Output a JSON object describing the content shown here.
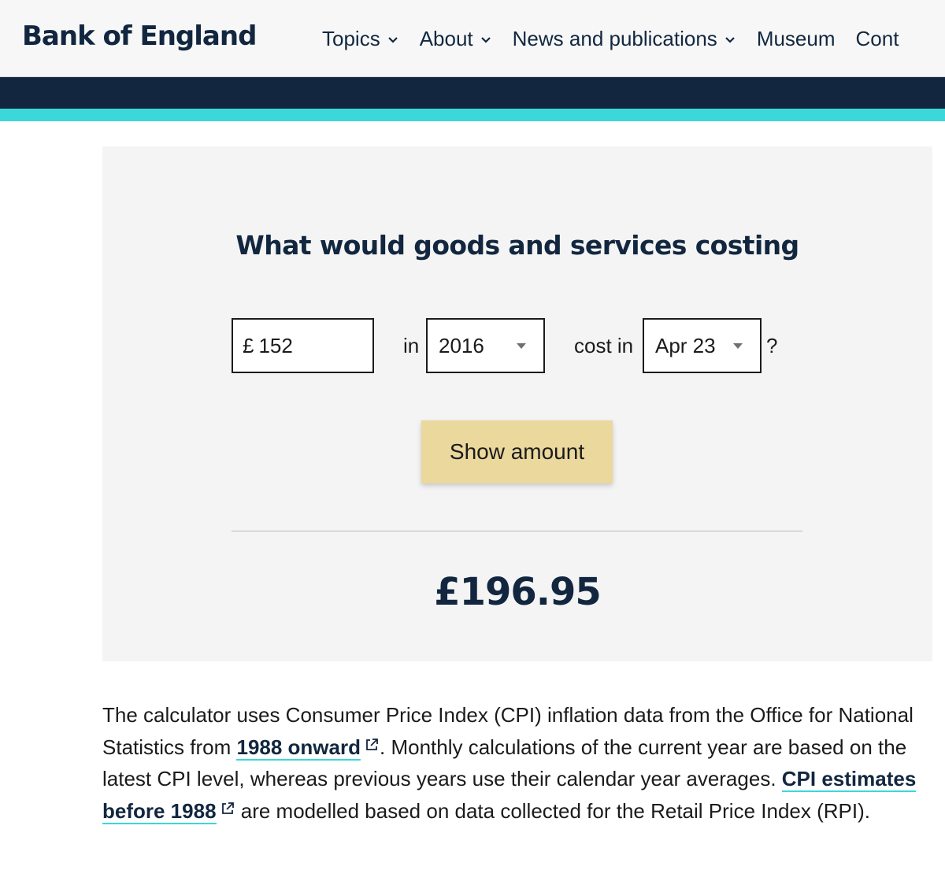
{
  "header": {
    "logo": "Bank of England",
    "nav": [
      {
        "label": "Topics",
        "has_dropdown": true
      },
      {
        "label": "About",
        "has_dropdown": true
      },
      {
        "label": "News and publications",
        "has_dropdown": true
      },
      {
        "label": "Museum",
        "has_dropdown": false
      },
      {
        "label": "Cont",
        "has_dropdown": false
      }
    ]
  },
  "calculator": {
    "title": "What would goods and services costing",
    "currency_symbol": "£",
    "amount": "152",
    "in_label": "in",
    "year_selected": "2016",
    "cost_in_label": "cost in",
    "month_selected": "Apr 23",
    "question_mark": "?",
    "button_label": "Show amount",
    "result": "£196.95"
  },
  "description": {
    "part1": "The calculator uses Consumer Price Index (CPI) inflation data from the Office for National Statistics from ",
    "link1": "1988 onward",
    "part2": ". Monthly calculations of the current year are based on the latest CPI level, whereas previous years use their calendar year averages. ",
    "link2": "CPI estimates before 1988",
    "part3": " are modelled based on data collected for the Retail Price Index (RPI)."
  },
  "colors": {
    "navy": "#12273f",
    "teal": "#3cd7d9",
    "button": "#ead89c",
    "panel": "#f4f4f4"
  },
  "icons": [
    "chevron-down-icon",
    "select-caret-icon",
    "external-link-icon"
  ]
}
